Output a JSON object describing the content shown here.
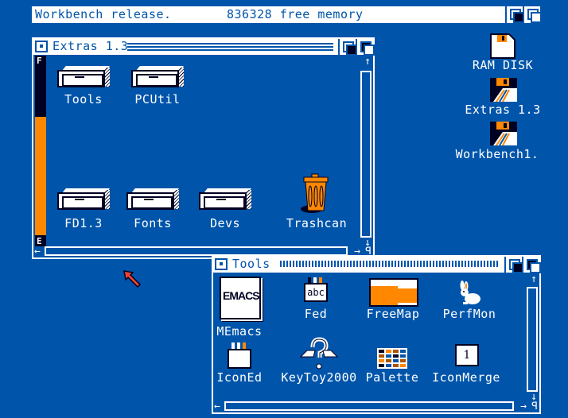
{
  "screen": {
    "title_left": "Workbench release.",
    "title_memory": "836328 free memory"
  },
  "colors": {
    "background": "#0055aa",
    "foreground": "#ffffff",
    "accent": "#ff8800",
    "dark": "#000022"
  },
  "desktop_icons": [
    {
      "label": "RAM DISK",
      "icon": "ram-disk-icon"
    },
    {
      "label": "Extras 1.3",
      "icon": "floppy-disk-icon"
    },
    {
      "label": "Workbench1.",
      "icon": "floppy-disk-icon"
    }
  ],
  "extras_window": {
    "title": "Extras 1.3",
    "gauge_full_label": "F",
    "gauge_empty_label": "E",
    "gauge_used_fraction": 0.62,
    "icons": [
      {
        "label": "Tools",
        "icon": "drawer-icon"
      },
      {
        "label": "PCUtil",
        "icon": "drawer-icon"
      },
      {
        "label": "FD1.3",
        "icon": "drawer-icon"
      },
      {
        "label": "Fonts",
        "icon": "drawer-icon"
      },
      {
        "label": "Devs",
        "icon": "drawer-icon"
      },
      {
        "label": "Trashcan",
        "icon": "trashcan-icon"
      }
    ]
  },
  "tools_window": {
    "title": "Tools",
    "icons": [
      {
        "label": "MEmacs",
        "icon": "emacs-notepad-icon",
        "icon_text": "EMACS"
      },
      {
        "label": "Fed",
        "icon": "font-editor-icon",
        "icon_text": "abc"
      },
      {
        "label": "FreeMap",
        "icon": "freemap-icon"
      },
      {
        "label": "PerfMon",
        "icon": "rabbit-icon"
      },
      {
        "label": "IconEd",
        "icon": "icon-editor-icon"
      },
      {
        "label": "KeyToy2000",
        "icon": "keyboard-question-icon"
      },
      {
        "label": "Palette",
        "icon": "palette-icon"
      },
      {
        "label": "IconMerge",
        "icon": "iconmerge-icon",
        "icon_text": "1"
      }
    ]
  }
}
